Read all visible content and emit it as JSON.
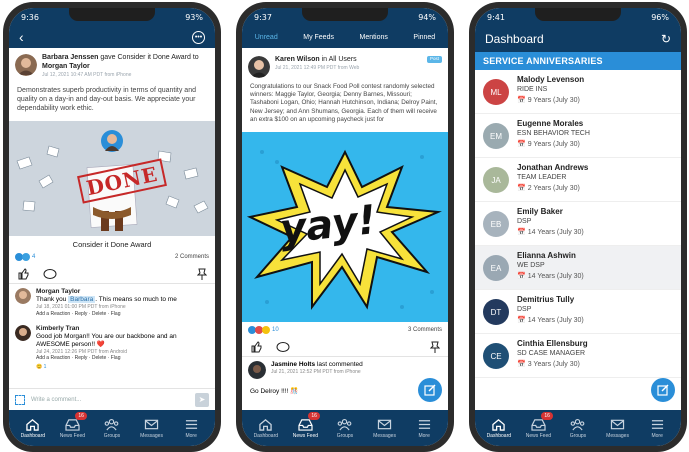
{
  "colors": {
    "nav": "#0f3c63",
    "accent": "#2a8ed8",
    "badge": "#d63333"
  },
  "nav": {
    "items": [
      {
        "label": "Dashboard",
        "icon": "home-icon"
      },
      {
        "label": "News Feed",
        "icon": "inbox-icon"
      },
      {
        "label": "Groups",
        "icon": "groups-icon"
      },
      {
        "label": "Messages",
        "icon": "mail-icon"
      },
      {
        "label": "More",
        "icon": "menu-icon"
      }
    ],
    "badge": "16"
  },
  "phone1": {
    "time": "9:36",
    "battery": "93%",
    "post": {
      "author": "Barbara Jenssen",
      "action": "gave Consider it Done Award to",
      "recipient": "Morgan Taylor",
      "meta": "Jul 12, 2021 10:47 AM PDT from iPhone",
      "body": "Demonstrates superb productivity in terms of quantity and quality on a day-in and day-out basis. We appreciate your dependability work ethic.",
      "award_stamp": "DONE",
      "award_caption": "Consider it Done Award",
      "reaction_count": "4",
      "comments_count": "2 Comments"
    },
    "comments": [
      {
        "name": "Morgan Taylor",
        "text_pre": "Thank you",
        "mention": "Barbara",
        "text_post": ". This means so much to me",
        "meta": "Jul 18, 2021 01:00 PM PDT from iPhone",
        "actions": "Add a Reaction · Reply · Delete · Flag"
      },
      {
        "name": "Kimberly Tran",
        "text": "Good job Morgan!! You are our backbone and an AWESOME person!! ❤️",
        "meta": "Jul 24, 2021 12:26 PM PDT from Android",
        "actions": "Add a Reaction · Reply · Delete · Flag",
        "reaction_count": "1"
      }
    ],
    "comment_placeholder": "Write a comment..."
  },
  "phone2": {
    "time": "9:37",
    "battery": "94%",
    "tabs": [
      "Unread",
      "My Feeds",
      "Mentions",
      "Pinned"
    ],
    "post": {
      "author": "Karen Wilson",
      "in": "in",
      "group": "All Users",
      "meta": "Jul 21, 2021 12:49 PM PDT from Web",
      "tag": "Post",
      "body": "Congratulations to our Snack Food Poll contest randomly selected winners: Maggie Taylor, Georgia; Denny Barnes, Missouri; Tashaboni Logan, Ohio; Hannah Hutchinson, Indiana; Delroy Paint, New Jersey; and Ann Shumans, Georgia. Each of them will receive an extra $100 on an upcoming paycheck just for",
      "image_text": "yay!",
      "reaction_count": "10",
      "comments_count": "3 Comments"
    },
    "last_comment": {
      "author": "Jasmine Holts",
      "label": "last commented",
      "meta": "Jul 21, 2021 12:52 PM PDT from iPhone",
      "text": "Go Delroy !!!! 🎊"
    }
  },
  "phone3": {
    "time": "9:41",
    "battery": "96%",
    "title": "Dashboard",
    "section": "SERVICE ANNIVERSARIES",
    "people": [
      {
        "initials": "ML",
        "name": "Malody Levenson",
        "role": "RIDE INS",
        "years": "9 Years (July 30)",
        "color": "#cc4444"
      },
      {
        "initials": "EM",
        "name": "Eugenne Morales",
        "role": "ESN BEHAVIOR TECH",
        "years": "9 Years (July 30)",
        "color": "#9aaab0"
      },
      {
        "initials": "JA",
        "name": "Jonathan Andrews",
        "role": "TEAM LEADER",
        "years": "2 Years (July 30)",
        "color": "#a9b89a"
      },
      {
        "initials": "EB",
        "name": "Emily Baker",
        "role": "DSP",
        "years": "14 Years (July 30)",
        "color": "#a7b3bd"
      },
      {
        "initials": "EA",
        "name": "Elianna Ashwin",
        "role": "WE DSP",
        "years": "14 Years (July 30)",
        "color": "#9aa8b3"
      },
      {
        "initials": "DT",
        "name": "Demitrius Tully",
        "role": "DSP",
        "years": "14 Years (July 30)",
        "color": "#233a5e"
      },
      {
        "initials": "CE",
        "name": "Cinthia Ellensburg",
        "role": "SD CASE MANAGER",
        "years": "3 Years (July 30)",
        "color": "#1f4f75"
      }
    ]
  }
}
